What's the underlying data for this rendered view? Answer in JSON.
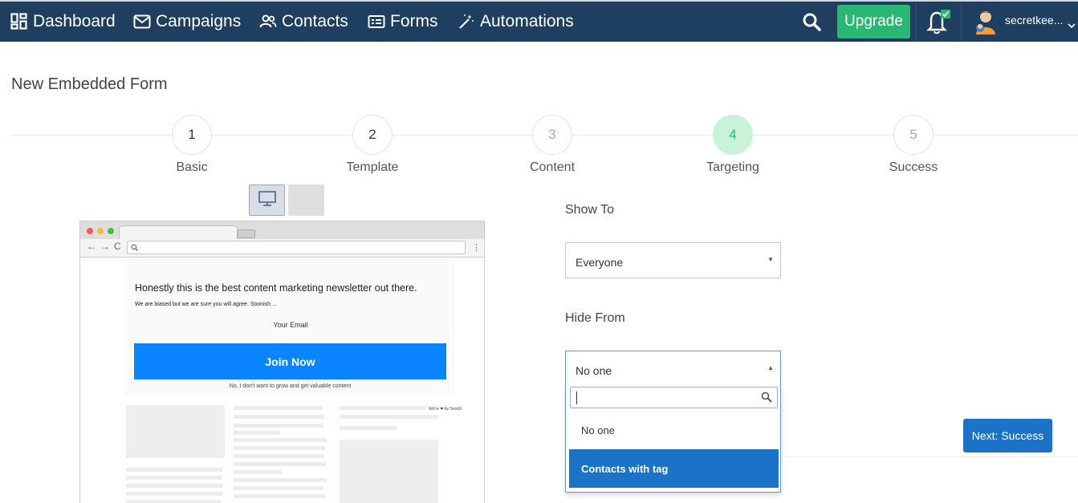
{
  "nav": {
    "items": [
      {
        "label": "Dashboard",
        "icon": "dashboard-icon"
      },
      {
        "label": "Campaigns",
        "icon": "mail-icon"
      },
      {
        "label": "Contacts",
        "icon": "contacts-icon"
      },
      {
        "label": "Forms",
        "icon": "form-icon"
      },
      {
        "label": "Automations",
        "icon": "magic-wand-icon"
      }
    ],
    "upgrade_label": "Upgrade",
    "username": "secretkee..."
  },
  "page": {
    "title": "New Embedded Form"
  },
  "stepper": {
    "steps": [
      {
        "number": "1",
        "label": "Basic"
      },
      {
        "number": "2",
        "label": "Template"
      },
      {
        "number": "3",
        "label": "Content"
      },
      {
        "number": "4",
        "label": "Targeting"
      },
      {
        "number": "5",
        "label": "Success"
      }
    ],
    "active_step": 4
  },
  "preview": {
    "headline": "Honestly this is the best content marketing newsletter out there.",
    "subhead": "We are biased but we are sure you will agree. Soonish ...",
    "email_label": "Your Email",
    "button_label": "Join Now",
    "decline_text": "No, I don't want to grow and get valuable content",
    "powered_by": "We're ❤ by SendX"
  },
  "targeting": {
    "show_to_label": "Show To",
    "show_to_value": "Everyone",
    "hide_from_label": "Hide From",
    "hide_from_value": "No one",
    "dropdown_options": [
      "No one",
      "Contacts with tag"
    ],
    "highlighted_option": "Contacts with tag",
    "search_value": ""
  },
  "actions": {
    "next_label": "Next: Success"
  },
  "colors": {
    "nav_bg": "#1f3f60",
    "upgrade": "#2ab673",
    "primary": "#1a73c7",
    "active_step_bg": "#c8f3d9",
    "join_button": "#0a84ff"
  }
}
